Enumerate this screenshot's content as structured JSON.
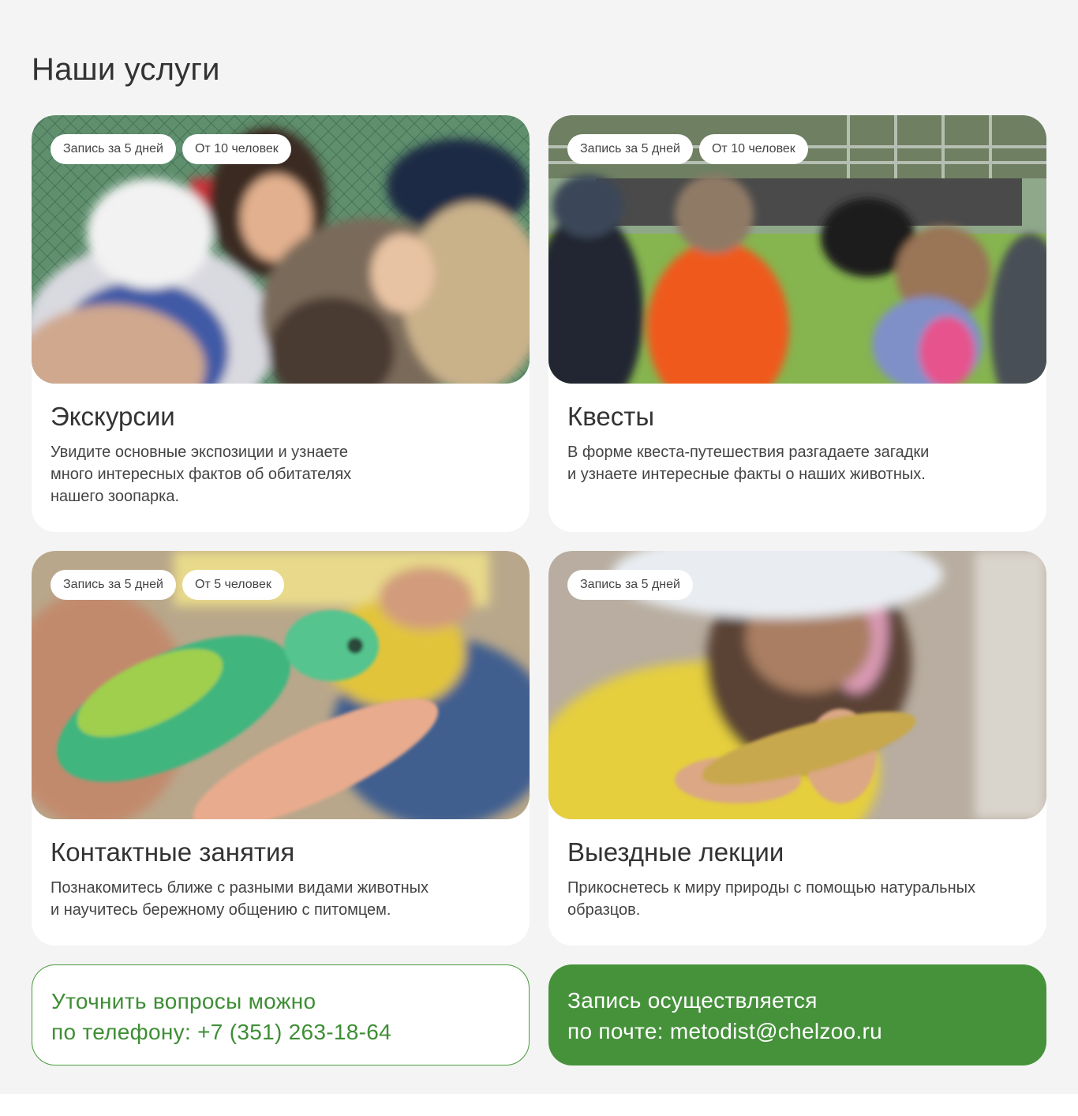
{
  "section": {
    "title": "Наши услуги"
  },
  "cards": [
    {
      "title": "Экскурсии",
      "description": "Увидите основные экспозиции и узнаете\nмного интересных фактов об обитателях\nнашего зоопарка.",
      "tags": [
        "Запись за 5 дней",
        "От 10 человек"
      ]
    },
    {
      "title": "Квесты",
      "description": "В форме квеста-путешествия разгадаете загадки\nи узнаете интересные факты о наших животных.",
      "tags": [
        "Запись за 5 дней",
        "От 10 человек"
      ]
    },
    {
      "title": "Контактные занятия",
      "description": "Познакомитесь ближе с разными видами животных\nи научитесь бережному общению с питомцем.",
      "tags": [
        "Запись за 5 дней",
        "От 5 человек"
      ]
    },
    {
      "title": "Выездные лекции",
      "description": "Прикоснетесь к миру природы с помощью натуральных\nобразцов.",
      "tags": [
        "Запись за 5 дней"
      ]
    }
  ],
  "contact": {
    "phone_text": "Уточнить вопросы можно\nпо телефону: +7 (351) 263-18-64",
    "email_text": "Запись осуществляется\nпо почте: metodist@chelzoo.ru"
  },
  "colors": {
    "accent_green": "#46923b",
    "background": "#f4f4f4",
    "card_background": "#ffffff"
  }
}
